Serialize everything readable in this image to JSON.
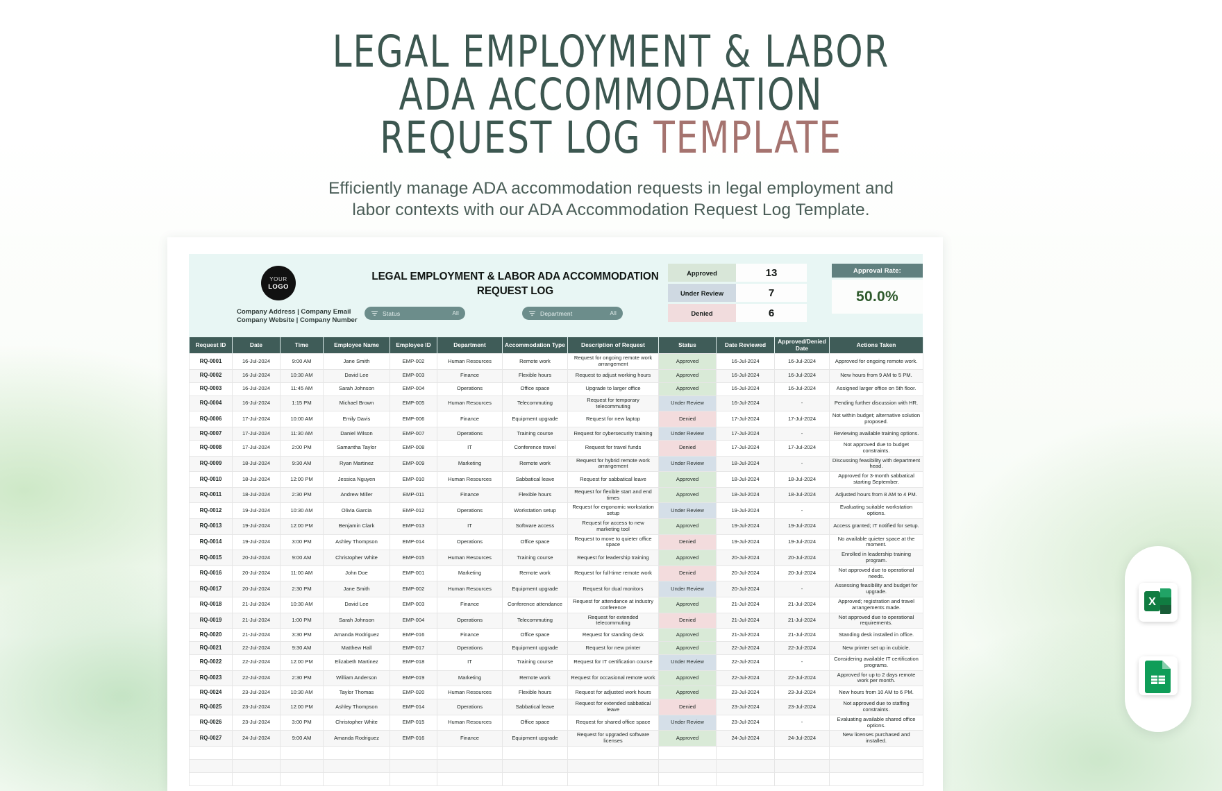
{
  "hero": {
    "title_line1": "LEGAL EMPLOYMENT & LABOR",
    "title_line2": "ADA ACCOMMODATION",
    "title_line3_main": "REQUEST LOG ",
    "title_line3_accent": "TEMPLATE",
    "subtitle_line1": "Efficiently manage ADA accommodation requests in legal employment and",
    "subtitle_line2": "labor contexts with our ADA Accommodation Request Log Template.",
    "accent_color": "#a5736f",
    "title_color": "#3c5750"
  },
  "sheet": {
    "logo": {
      "line1": "YOUR",
      "line2": "LOGO"
    },
    "company_line1": "Company Address | Company Email",
    "company_line2": "Company Website | Company Number",
    "title_line1": "LEGAL EMPLOYMENT & LABOR ADA ACCOMMODATION",
    "title_line2": "REQUEST LOG",
    "filters": [
      {
        "icon": "filter-icon",
        "label": "Status",
        "value": "All"
      },
      {
        "icon": "filter-icon",
        "label": "Department",
        "value": "All"
      }
    ],
    "kpis": [
      {
        "name": "Approved",
        "value": "13",
        "color": "#d8e6d8"
      },
      {
        "name": "Under Review",
        "value": "7",
        "color": "#cfd9e2"
      },
      {
        "name": "Denied",
        "value": "6",
        "color": "#f1dcdd"
      }
    ],
    "approval_rate": {
      "label": "Approval Rate:",
      "value": "50.0%",
      "color": "#2e5a2c"
    },
    "columns": [
      "Request ID",
      "Date",
      "Time",
      "Employee Name",
      "Employee ID",
      "Department",
      "Accommodation Type",
      "Description of Request",
      "Status",
      "Date Reviewed",
      "Approved/Denied Date",
      "Actions Taken"
    ],
    "rows": [
      {
        "id": "RQ-0001",
        "date": "16-Jul-2024",
        "time": "9:00 AM",
        "name": "Jane Smith",
        "emp": "EMP-002",
        "dept": "Human Resources",
        "type": "Remote work",
        "desc": "Request for ongoing remote work arrangement",
        "status": "Approved",
        "reviewed": "16-Jul-2024",
        "decided": "16-Jul-2024",
        "action": "Approved for ongoing remote work."
      },
      {
        "id": "RQ-0002",
        "date": "16-Jul-2024",
        "time": "10:30 AM",
        "name": "David Lee",
        "emp": "EMP-003",
        "dept": "Finance",
        "type": "Flexible hours",
        "desc": "Request to adjust working hours",
        "status": "Approved",
        "reviewed": "16-Jul-2024",
        "decided": "16-Jul-2024",
        "action": "New hours from 9 AM to 5 PM."
      },
      {
        "id": "RQ-0003",
        "date": "16-Jul-2024",
        "time": "11:45 AM",
        "name": "Sarah Johnson",
        "emp": "EMP-004",
        "dept": "Operations",
        "type": "Office space",
        "desc": "Upgrade to larger office",
        "status": "Approved",
        "reviewed": "16-Jul-2024",
        "decided": "16-Jul-2024",
        "action": "Assigned larger office on 5th floor."
      },
      {
        "id": "RQ-0004",
        "date": "16-Jul-2024",
        "time": "1:15 PM",
        "name": "Michael Brown",
        "emp": "EMP-005",
        "dept": "Human Resources",
        "type": "Telecommuting",
        "desc": "Request for temporary telecommuting",
        "status": "Under Review",
        "reviewed": "16-Jul-2024",
        "decided": "-",
        "action": "Pending further discussion with HR."
      },
      {
        "id": "RQ-0006",
        "date": "17-Jul-2024",
        "time": "10:00 AM",
        "name": "Emily Davis",
        "emp": "EMP-006",
        "dept": "Finance",
        "type": "Equipment upgrade",
        "desc": "Request for new laptop",
        "status": "Denied",
        "reviewed": "17-Jul-2024",
        "decided": "17-Jul-2024",
        "action": "Not within budget; alternative solution proposed."
      },
      {
        "id": "RQ-0007",
        "date": "17-Jul-2024",
        "time": "11:30 AM",
        "name": "Daniel Wilson",
        "emp": "EMP-007",
        "dept": "Operations",
        "type": "Training course",
        "desc": "Request for cybersecurity training",
        "status": "Under Review",
        "reviewed": "17-Jul-2024",
        "decided": "-",
        "action": "Reviewing available training options."
      },
      {
        "id": "RQ-0008",
        "date": "17-Jul-2024",
        "time": "2:00 PM",
        "name": "Samantha Taylor",
        "emp": "EMP-008",
        "dept": "IT",
        "type": "Conference travel",
        "desc": "Request for travel funds",
        "status": "Denied",
        "reviewed": "17-Jul-2024",
        "decided": "17-Jul-2024",
        "action": "Not approved due to budget constraints."
      },
      {
        "id": "RQ-0009",
        "date": "18-Jul-2024",
        "time": "9:30 AM",
        "name": "Ryan Martinez",
        "emp": "EMP-009",
        "dept": "Marketing",
        "type": "Remote work",
        "desc": "Request for hybrid remote work arrangement",
        "status": "Under Review",
        "reviewed": "18-Jul-2024",
        "decided": "-",
        "action": "Discussing feasibility with department head."
      },
      {
        "id": "RQ-0010",
        "date": "18-Jul-2024",
        "time": "12:00 PM",
        "name": "Jessica Nguyen",
        "emp": "EMP-010",
        "dept": "Human Resources",
        "type": "Sabbatical leave",
        "desc": "Request for sabbatical leave",
        "status": "Approved",
        "reviewed": "18-Jul-2024",
        "decided": "18-Jul-2024",
        "action": "Approved for 3-month sabbatical starting September."
      },
      {
        "id": "RQ-0011",
        "date": "18-Jul-2024",
        "time": "2:30 PM",
        "name": "Andrew Miller",
        "emp": "EMP-011",
        "dept": "Finance",
        "type": "Flexible hours",
        "desc": "Request for flexible start and end times",
        "status": "Approved",
        "reviewed": "18-Jul-2024",
        "decided": "18-Jul-2024",
        "action": "Adjusted hours from 8 AM to 4 PM."
      },
      {
        "id": "RQ-0012",
        "date": "19-Jul-2024",
        "time": "10:30 AM",
        "name": "Olivia Garcia",
        "emp": "EMP-012",
        "dept": "Operations",
        "type": "Workstation setup",
        "desc": "Request for ergonomic workstation setup",
        "status": "Under Review",
        "reviewed": "19-Jul-2024",
        "decided": "-",
        "action": "Evaluating suitable workstation options."
      },
      {
        "id": "RQ-0013",
        "date": "19-Jul-2024",
        "time": "12:00 PM",
        "name": "Benjamin Clark",
        "emp": "EMP-013",
        "dept": "IT",
        "type": "Software access",
        "desc": "Request for access to new marketing tool",
        "status": "Approved",
        "reviewed": "19-Jul-2024",
        "decided": "19-Jul-2024",
        "action": "Access granted; IT notified for setup."
      },
      {
        "id": "RQ-0014",
        "date": "19-Jul-2024",
        "time": "3:00 PM",
        "name": "Ashley Thompson",
        "emp": "EMP-014",
        "dept": "Operations",
        "type": "Office space",
        "desc": "Request to move to quieter office space",
        "status": "Denied",
        "reviewed": "19-Jul-2024",
        "decided": "19-Jul-2024",
        "action": "No available quieter space at the moment."
      },
      {
        "id": "RQ-0015",
        "date": "20-Jul-2024",
        "time": "9:00 AM",
        "name": "Christopher White",
        "emp": "EMP-015",
        "dept": "Human Resources",
        "type": "Training course",
        "desc": "Request for leadership training",
        "status": "Approved",
        "reviewed": "20-Jul-2024",
        "decided": "20-Jul-2024",
        "action": "Enrolled in leadership training program."
      },
      {
        "id": "RQ-0016",
        "date": "20-Jul-2024",
        "time": "11:00 AM",
        "name": "John Doe",
        "emp": "EMP-001",
        "dept": "Marketing",
        "type": "Remote work",
        "desc": "Request for full-time remote work",
        "status": "Denied",
        "reviewed": "20-Jul-2024",
        "decided": "20-Jul-2024",
        "action": "Not approved due to operational needs."
      },
      {
        "id": "RQ-0017",
        "date": "20-Jul-2024",
        "time": "2:30 PM",
        "name": "Jane Smith",
        "emp": "EMP-002",
        "dept": "Human Resources",
        "type": "Equipment upgrade",
        "desc": "Request for dual monitors",
        "status": "Under Review",
        "reviewed": "20-Jul-2024",
        "decided": "-",
        "action": "Assessing feasibility and budget for upgrade."
      },
      {
        "id": "RQ-0018",
        "date": "21-Jul-2024",
        "time": "10:30 AM",
        "name": "David Lee",
        "emp": "EMP-003",
        "dept": "Finance",
        "type": "Conference attendance",
        "desc": "Request for attendance at industry conference",
        "status": "Approved",
        "reviewed": "21-Jul-2024",
        "decided": "21-Jul-2024",
        "action": "Approved; registration and travel arrangements made."
      },
      {
        "id": "RQ-0019",
        "date": "21-Jul-2024",
        "time": "1:00 PM",
        "name": "Sarah Johnson",
        "emp": "EMP-004",
        "dept": "Operations",
        "type": "Telecommuting",
        "desc": "Request for extended telecommuting",
        "status": "Denied",
        "reviewed": "21-Jul-2024",
        "decided": "21-Jul-2024",
        "action": "Not approved due to operational requirements."
      },
      {
        "id": "RQ-0020",
        "date": "21-Jul-2024",
        "time": "3:30 PM",
        "name": "Amanda Rodriguez",
        "emp": "EMP-016",
        "dept": "Finance",
        "type": "Office space",
        "desc": "Request for standing desk",
        "status": "Approved",
        "reviewed": "21-Jul-2024",
        "decided": "21-Jul-2024",
        "action": "Standing desk installed in office."
      },
      {
        "id": "RQ-0021",
        "date": "22-Jul-2024",
        "time": "9:30 AM",
        "name": "Matthew Hall",
        "emp": "EMP-017",
        "dept": "Operations",
        "type": "Equipment upgrade",
        "desc": "Request for new printer",
        "status": "Approved",
        "reviewed": "22-Jul-2024",
        "decided": "22-Jul-2024",
        "action": "New printer set up in cubicle."
      },
      {
        "id": "RQ-0022",
        "date": "22-Jul-2024",
        "time": "12:00 PM",
        "name": "Elizabeth Martinez",
        "emp": "EMP-018",
        "dept": "IT",
        "type": "Training course",
        "desc": "Request for IT certification course",
        "status": "Under Review",
        "reviewed": "22-Jul-2024",
        "decided": "-",
        "action": "Considering available IT certification programs."
      },
      {
        "id": "RQ-0023",
        "date": "22-Jul-2024",
        "time": "2:30 PM",
        "name": "William Anderson",
        "emp": "EMP-019",
        "dept": "Marketing",
        "type": "Remote work",
        "desc": "Request for occasional remote work",
        "status": "Approved",
        "reviewed": "22-Jul-2024",
        "decided": "22-Jul-2024",
        "action": "Approved for up to 2 days remote work per month."
      },
      {
        "id": "RQ-0024",
        "date": "23-Jul-2024",
        "time": "10:30 AM",
        "name": "Taylor Thomas",
        "emp": "EMP-020",
        "dept": "Human Resources",
        "type": "Flexible hours",
        "desc": "Request for adjusted work hours",
        "status": "Approved",
        "reviewed": "23-Jul-2024",
        "decided": "23-Jul-2024",
        "action": "New hours from 10 AM to 6 PM."
      },
      {
        "id": "RQ-0025",
        "date": "23-Jul-2024",
        "time": "12:00 PM",
        "name": "Ashley Thompson",
        "emp": "EMP-014",
        "dept": "Operations",
        "type": "Sabbatical leave",
        "desc": "Request for extended sabbatical leave",
        "status": "Denied",
        "reviewed": "23-Jul-2024",
        "decided": "23-Jul-2024",
        "action": "Not approved due to staffing constraints."
      },
      {
        "id": "RQ-0026",
        "date": "23-Jul-2024",
        "time": "3:00 PM",
        "name": "Christopher White",
        "emp": "EMP-015",
        "dept": "Human Resources",
        "type": "Office space",
        "desc": "Request for shared office space",
        "status": "Under Review",
        "reviewed": "23-Jul-2024",
        "decided": "-",
        "action": "Evaluating available shared office options."
      },
      {
        "id": "RQ-0027",
        "date": "24-Jul-2024",
        "time": "9:00 AM",
        "name": "Amanda Rodriguez",
        "emp": "EMP-016",
        "dept": "Finance",
        "type": "Equipment upgrade",
        "desc": "Request for upgraded software licenses",
        "status": "Approved",
        "reviewed": "24-Jul-2024",
        "decided": "24-Jul-2024",
        "action": "New licenses purchased and installed."
      }
    ]
  },
  "file_chips": [
    {
      "name": "excel-file-icon",
      "label": "X"
    },
    {
      "name": "google-sheets-file-icon",
      "label": ""
    }
  ]
}
